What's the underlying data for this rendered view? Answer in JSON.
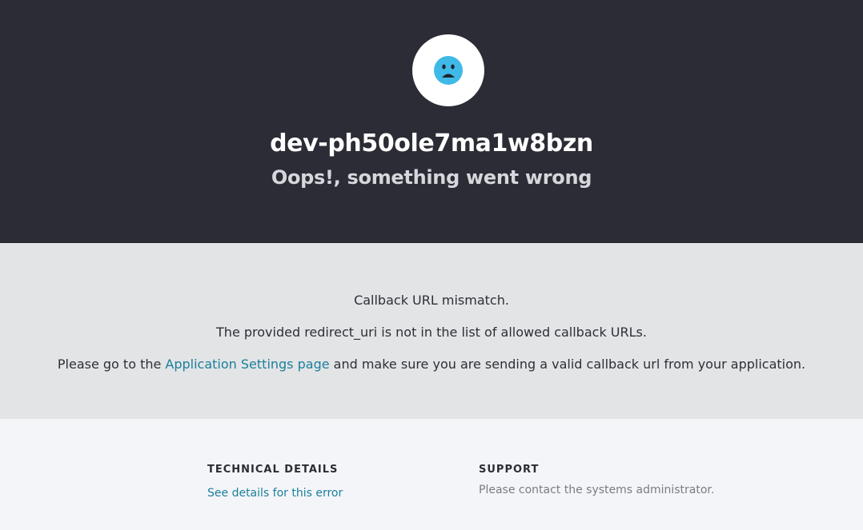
{
  "header": {
    "avatar_icon": "sad-face-icon",
    "tenant_name": "dev-ph50ole7ma1w8bzn",
    "error_title": "Oops!, something went wrong",
    "colors": {
      "background": "#2b2c35",
      "face": "#3fb9e8"
    }
  },
  "message": {
    "line1": "Callback URL mismatch.",
    "line2": "The provided redirect_uri is not in the list of allowed callback URLs.",
    "line3_prefix": "Please go to the ",
    "line3_link": "Application Settings page",
    "line3_suffix": " and make sure you are sending a valid callback url from your application."
  },
  "footer": {
    "technical_heading": "TECHNICAL DETAILS",
    "technical_link": "See details for this error",
    "support_heading": "SUPPORT",
    "support_text": "Please contact the systems administrator."
  }
}
